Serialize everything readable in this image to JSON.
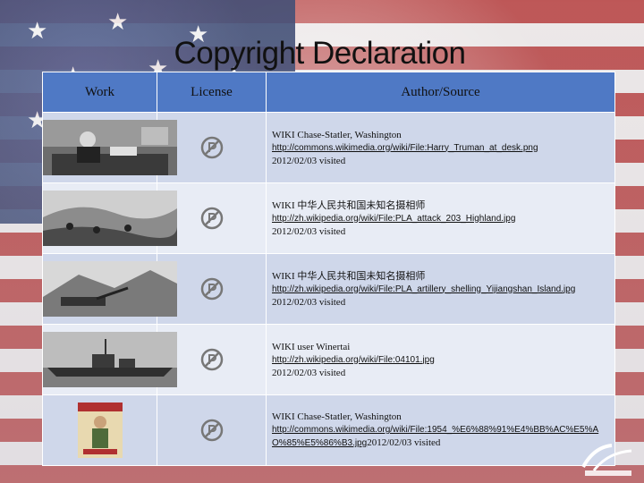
{
  "title": "Copyright Declaration",
  "columns": [
    "Work",
    "License",
    "Author/Source"
  ],
  "rows": [
    {
      "thumb": "photo-truman-desk",
      "license_icon": "public-domain-icon",
      "author": "WIKI  Chase-Statler, Washington",
      "url": "http://commons.wikimedia.org/wiki/File:Harry_Truman_at_desk.png",
      "url_suffix": "",
      "visited": "2012/02/03 visited"
    },
    {
      "thumb": "photo-pla-attack",
      "license_icon": "public-domain-icon",
      "author": "WIKI 中华人民共和国未知名摄相师",
      "url": "http://zh.wikipedia.org/wiki/File:PLA_attack_203_Highland.jpg",
      "url_suffix": "",
      "visited": "2012/02/03 visited"
    },
    {
      "thumb": "photo-pla-artillery",
      "license_icon": "public-domain-icon",
      "author": "WIKI 中华人民共和国未知名摄相师",
      "url": "http://zh.wikipedia.org/wiki/File:PLA_artillery_shelling_Yijiangshan_Island.jpg",
      "url_suffix": "2012/02/03 visited",
      "visited": ""
    },
    {
      "thumb": "photo-warship",
      "license_icon": "public-domain-icon",
      "author": "WIKI user Winertai",
      "url": "http://zh.wikipedia.org/wiki/File:04101.jpg",
      "url_suffix": "",
      "visited": "2012/02/03 visited"
    },
    {
      "thumb": "poster-propaganda",
      "license_icon": "public-domain-icon",
      "author": "WIKI Chase-Statler, Washington",
      "url": "http://commons.wikimedia.org/wiki/File:1954_%E6%88%91%E4%BB%AC%E5%AO%85%E5%86%B3.jpg",
      "url_suffix": "2012/02/03 visited",
      "visited": ""
    }
  ]
}
